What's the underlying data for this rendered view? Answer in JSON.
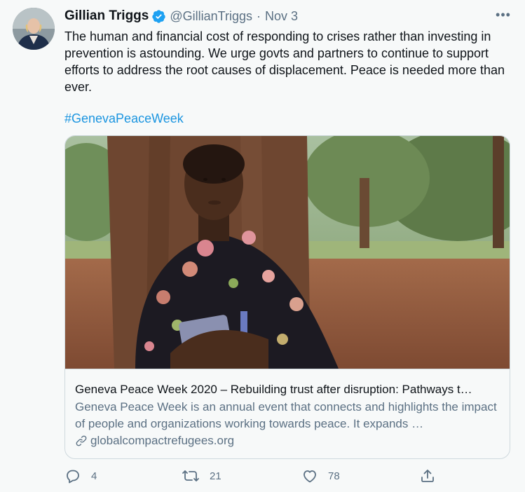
{
  "tweet": {
    "display_name": "Gillian Triggs",
    "handle": "@GillianTriggs",
    "separator": "·",
    "date": "Nov 3",
    "text": "The human and financial cost of responding to crises rather than investing in prevention is astounding. We urge govts and partners to continue to support efforts to address the root causes of displacement. Peace is needed more than ever.",
    "hashtag": "#GenevaPeaceWeek",
    "more_label": "•••"
  },
  "card": {
    "title": "Geneva Peace Week 2020 – Rebuilding trust after disruption: Pathways t…",
    "description": "Geneva Peace Week is an annual event that connects and highlights the impact of people and organizations working towards peace. It expands …",
    "domain": "globalcompactrefugees.org"
  },
  "actions": {
    "reply_count": "4",
    "retweet_count": "21",
    "like_count": "78"
  },
  "icons": {
    "verified": "verified-badge-icon",
    "more": "more-options-icon",
    "link": "link-icon",
    "reply": "reply-icon",
    "retweet": "retweet-icon",
    "like": "heart-icon",
    "share": "share-icon"
  },
  "colors": {
    "accent": "#1da1f2",
    "hashtag": "#1b95e0",
    "secondary_text": "#5b7083",
    "border": "#cfd9de",
    "background": "#f7f9f9"
  }
}
